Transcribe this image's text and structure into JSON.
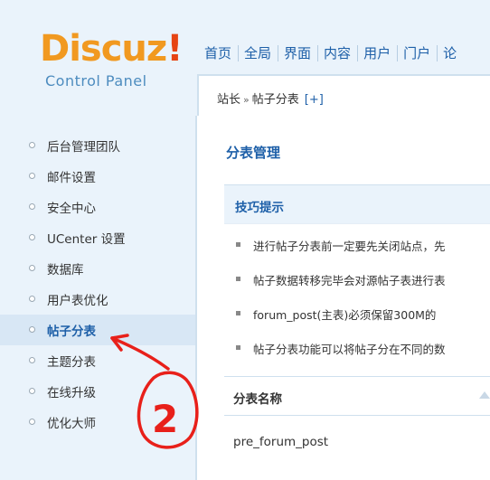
{
  "logo": {
    "main": "Discuz",
    "bang": "!",
    "sub": "Control Panel"
  },
  "nav": [
    "首页",
    "全局",
    "界面",
    "内容",
    "用户",
    "门户",
    "论"
  ],
  "breadcrumb": {
    "parent": "站长",
    "separator": "»",
    "current": "帖子分表",
    "plus": "[+]"
  },
  "sidebar": {
    "items": [
      {
        "label": "后台管理团队"
      },
      {
        "label": "邮件设置"
      },
      {
        "label": "安全中心"
      },
      {
        "label": "UCenter 设置"
      },
      {
        "label": "数据库"
      },
      {
        "label": "用户表优化"
      },
      {
        "label": "帖子分表"
      },
      {
        "label": "主题分表"
      },
      {
        "label": "在线升级"
      },
      {
        "label": "优化大师"
      }
    ],
    "active_index": 6
  },
  "main": {
    "title": "分表管理",
    "tips_title": "技巧提示",
    "tips": [
      "进行帖子分表前一定要先关闭站点，先",
      "帖子数据转移完毕会对源帖子表进行表",
      "forum_post(主表)必须保留300M的",
      "帖子分表功能可以将帖子分在不同的数"
    ],
    "table": {
      "header": "分表名称",
      "rows": [
        "pre_forum_post"
      ]
    }
  },
  "annotation": {
    "label": "2",
    "color": "#e8201a"
  }
}
